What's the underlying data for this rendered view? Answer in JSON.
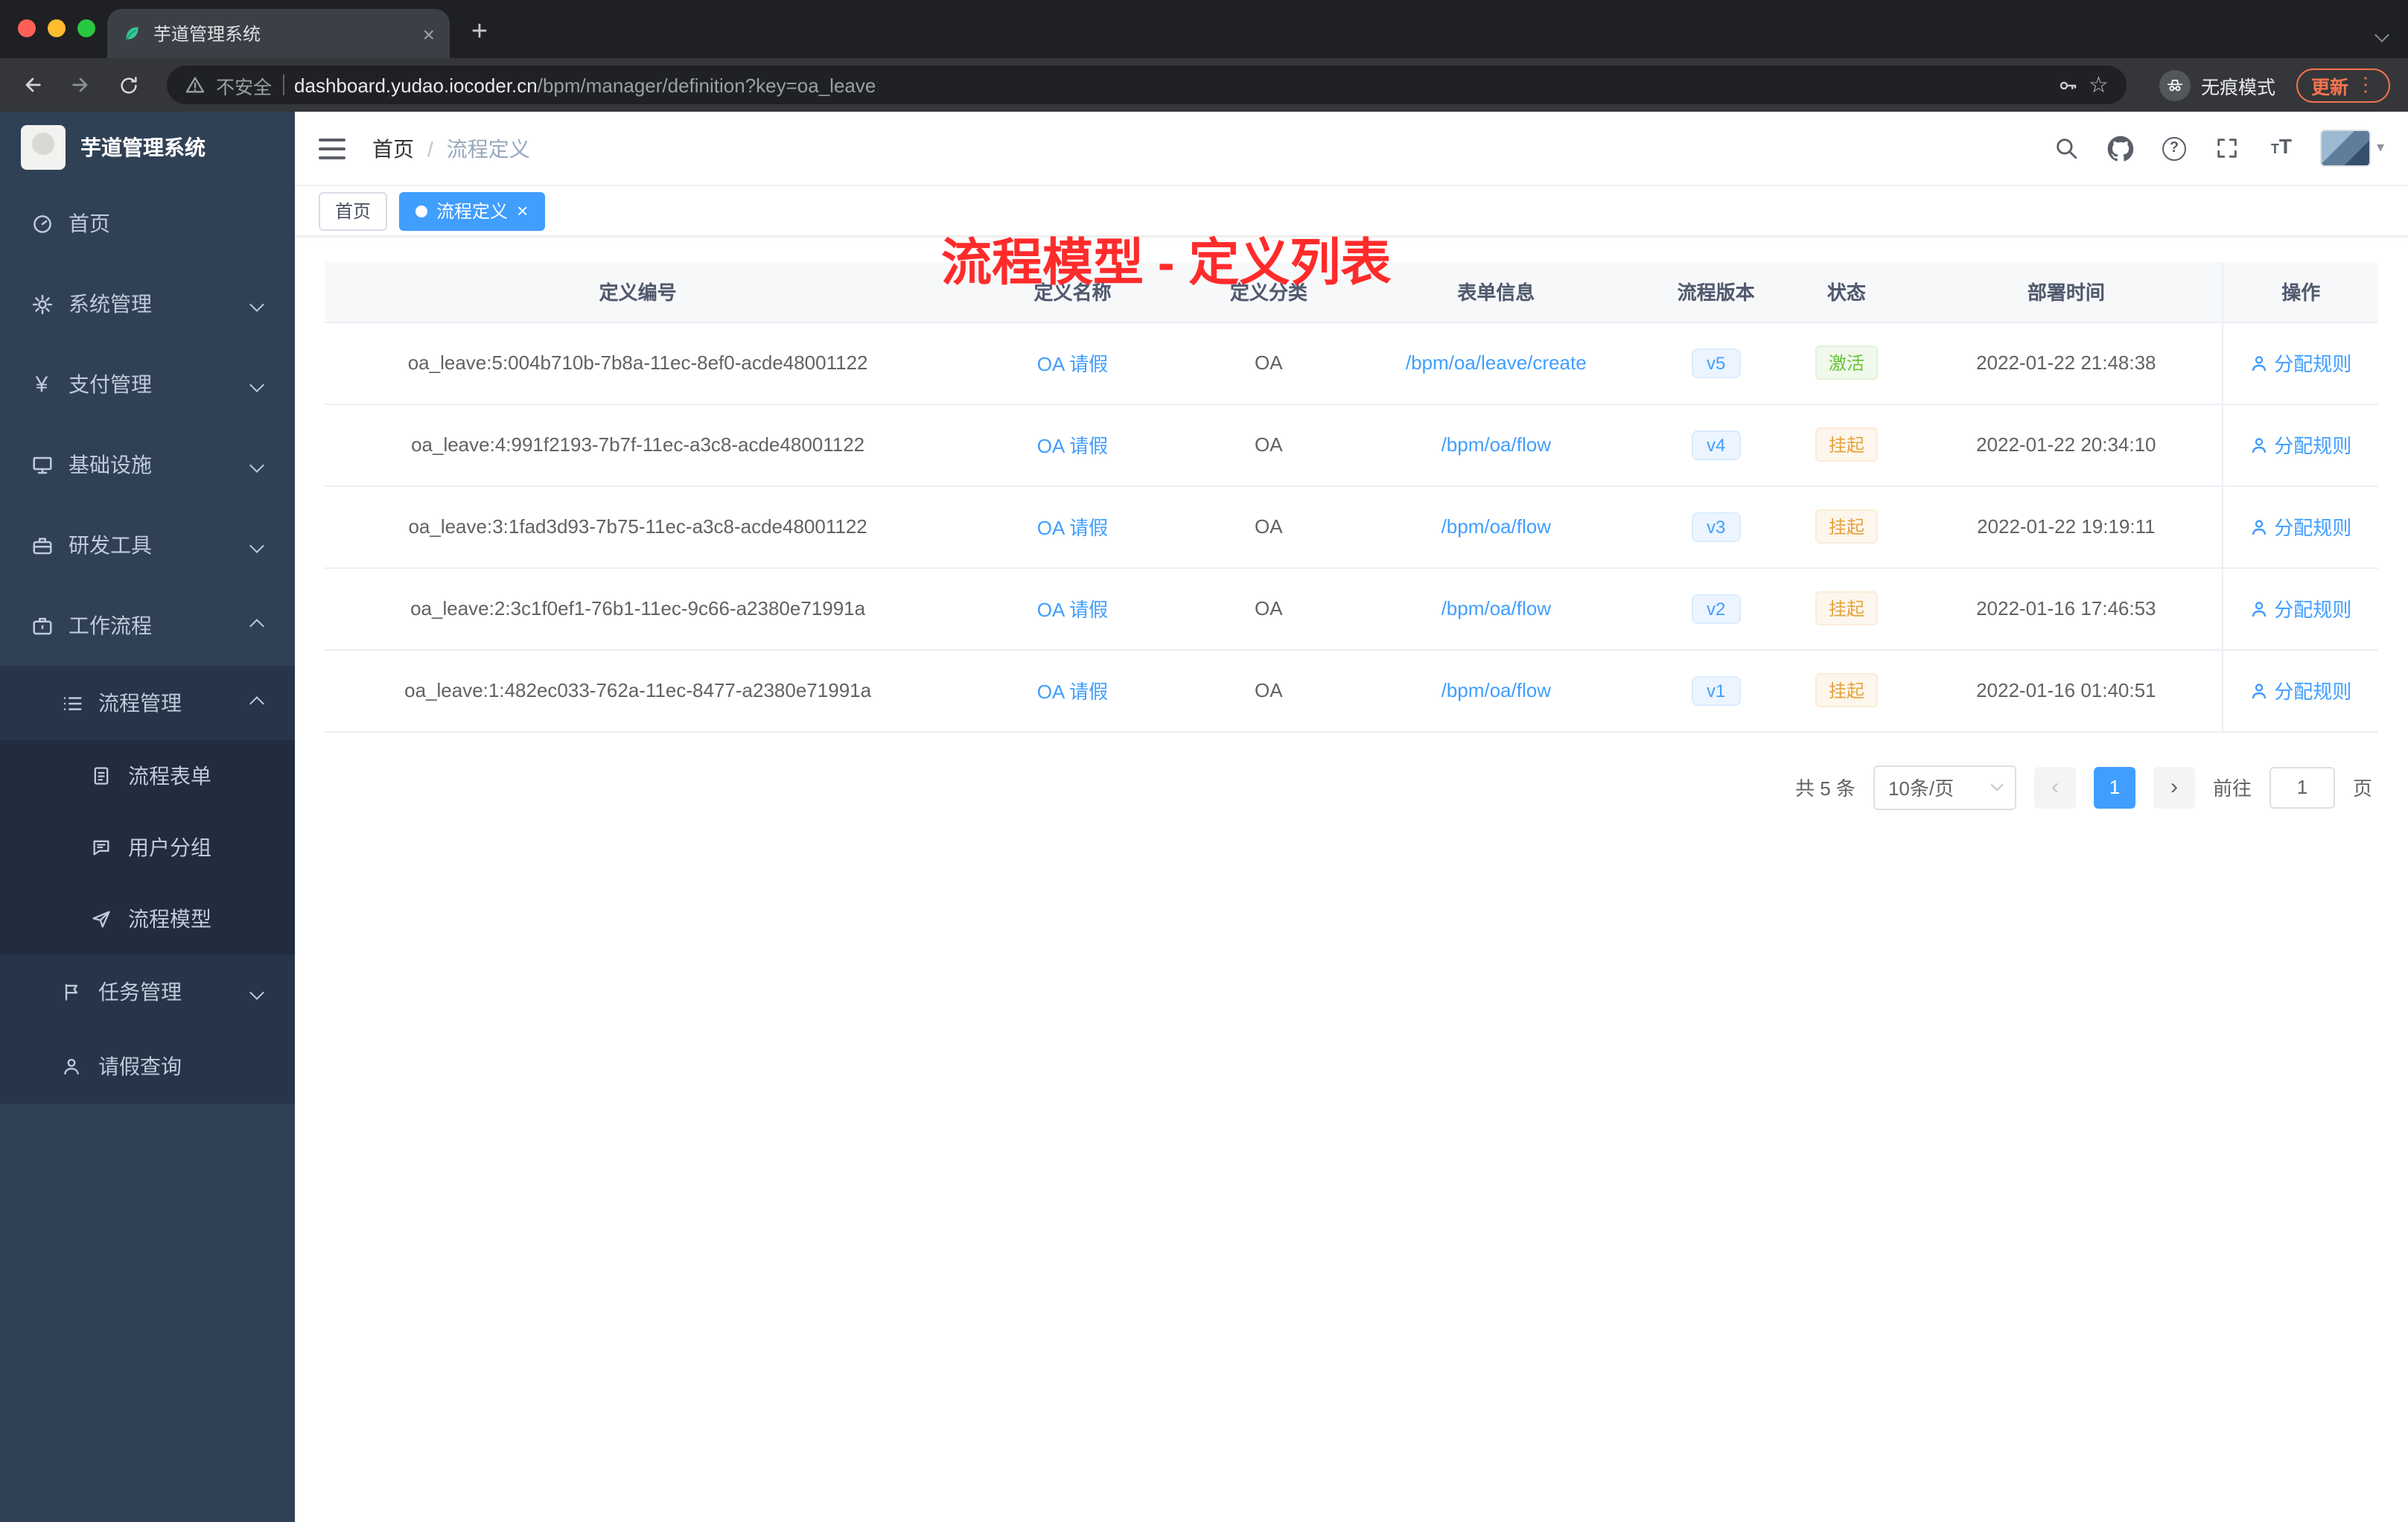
{
  "colors": {
    "accent": "#409eff",
    "annotation": "#ff2b2b",
    "update": "#f3734e",
    "success": "#67c23a",
    "warning": "#e6a23c"
  },
  "icons": {
    "tab_close": "×",
    "new_tab": "+",
    "star": "☆",
    "menu_dots": "⋮",
    "prev": "‹",
    "next": "›",
    "question": "?",
    "tag_close": "×",
    "font_small": "T",
    "font_large": "T",
    "yen": "¥",
    "caret": "▾"
  },
  "browser": {
    "tab_title": "芋道管理系统",
    "security_label": "不安全",
    "url_domain": "dashboard.yudao.iocoder.cn",
    "url_path": "/bpm/manager/definition?key=oa_leave",
    "incognito_label": "无痕模式",
    "update_label": "更新"
  },
  "sidebar": {
    "logo_title": "芋道管理系统",
    "items": [
      {
        "label": "首页"
      },
      {
        "label": "系统管理"
      },
      {
        "label": "支付管理"
      },
      {
        "label": "基础设施"
      },
      {
        "label": "研发工具"
      },
      {
        "label": "工作流程"
      },
      {
        "label": "流程管理"
      },
      {
        "label": "流程表单"
      },
      {
        "label": "用户分组"
      },
      {
        "label": "流程模型"
      },
      {
        "label": "任务管理"
      },
      {
        "label": "请假查询"
      }
    ]
  },
  "header": {
    "breadcrumb_home": "首页",
    "breadcrumb_sep": "/",
    "breadcrumb_current": "流程定义",
    "annotation": "流程模型 - 定义列表"
  },
  "tags": {
    "home": "首页",
    "active": "流程定义"
  },
  "table": {
    "columns": [
      "定义编号",
      "定义名称",
      "定义分类",
      "表单信息",
      "流程版本",
      "状态",
      "部署时间",
      "操作"
    ],
    "rows": [
      {
        "id": "oa_leave:5:004b710b-7b8a-11ec-8ef0-acde48001122",
        "name": "OA 请假",
        "category": "OA",
        "form": "/bpm/oa/leave/create",
        "version": "v5",
        "status": "激活",
        "status_type": "success",
        "time": "2022-01-22 21:48:38",
        "action": "分配规则"
      },
      {
        "id": "oa_leave:4:991f2193-7b7f-11ec-a3c8-acde48001122",
        "name": "OA 请假",
        "category": "OA",
        "form": "/bpm/oa/flow",
        "version": "v4",
        "status": "挂起",
        "status_type": "warning",
        "time": "2022-01-22 20:34:10",
        "action": "分配规则"
      },
      {
        "id": "oa_leave:3:1fad3d93-7b75-11ec-a3c8-acde48001122",
        "name": "OA 请假",
        "category": "OA",
        "form": "/bpm/oa/flow",
        "version": "v3",
        "status": "挂起",
        "status_type": "warning",
        "time": "2022-01-22 19:19:11",
        "action": "分配规则"
      },
      {
        "id": "oa_leave:2:3c1f0ef1-76b1-11ec-9c66-a2380e71991a",
        "name": "OA 请假",
        "category": "OA",
        "form": "/bpm/oa/flow",
        "version": "v2",
        "status": "挂起",
        "status_type": "warning",
        "time": "2022-01-16 17:46:53",
        "action": "分配规则"
      },
      {
        "id": "oa_leave:1:482ec033-762a-11ec-8477-a2380e71991a",
        "name": "OA 请假",
        "category": "OA",
        "form": "/bpm/oa/flow",
        "version": "v1",
        "status": "挂起",
        "status_type": "warning",
        "time": "2022-01-16 01:40:51",
        "action": "分配规则"
      }
    ]
  },
  "pagination": {
    "total": "共 5 条",
    "page_size": "10条/页",
    "page": "1",
    "goto": "前往",
    "goto_value": "1",
    "unit": "页"
  }
}
